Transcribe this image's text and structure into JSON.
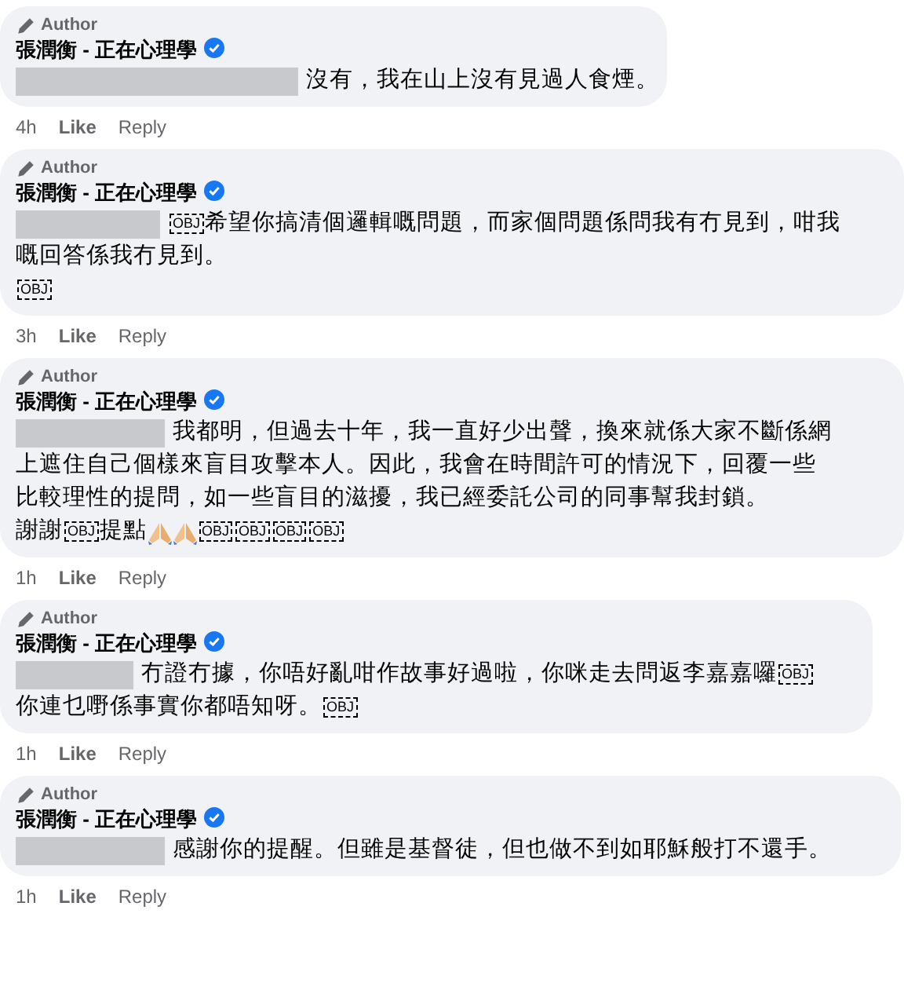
{
  "comments": [
    {
      "badge": "Author",
      "name": "張潤衡 - 正在心理學",
      "lines": [
        [
          {
            "kind": "redacted"
          },
          {
            "kind": "text",
            "text": "沒有，我在山上沒有見過人食煙。"
          }
        ]
      ],
      "time": "4h",
      "like": "Like",
      "reply": "Reply"
    },
    {
      "badge": "Author",
      "name": "張潤衡 - 正在心理學",
      "lines": [
        [
          {
            "kind": "redacted"
          },
          {
            "kind": "obj",
            "text": "OBJ"
          },
          {
            "kind": "text",
            "text": "希望你搞清個邏輯嘅問題，而家個問題係問我有冇見到，咁我"
          }
        ],
        [
          {
            "kind": "text",
            "text": "嘅回答係我冇見到。"
          }
        ],
        [
          {
            "kind": "obj",
            "text": "OBJ"
          }
        ]
      ],
      "time": "3h",
      "like": "Like",
      "reply": "Reply"
    },
    {
      "badge": "Author",
      "name": "張潤衡 - 正在心理學",
      "lines": [
        [
          {
            "kind": "redacted"
          },
          {
            "kind": "text",
            "text": "我都明，但過去十年，我一直好少出聲，換來就係大家不斷係網"
          }
        ],
        [
          {
            "kind": "text",
            "text": "上遮住自己個樣來盲目攻擊本人。因此，我會在時間許可的情況下，回覆一些"
          }
        ],
        [
          {
            "kind": "text",
            "text": "比較理性的提問，如一些盲目的滋擾，我已經委託公司的同事幫我封鎖。"
          }
        ],
        [
          {
            "kind": "text",
            "text": "謝謝"
          },
          {
            "kind": "obj",
            "text": "OBJ"
          },
          {
            "kind": "text",
            "text": "提點"
          },
          {
            "kind": "hands"
          },
          {
            "kind": "hands"
          },
          {
            "kind": "obj",
            "text": "OBJ"
          },
          {
            "kind": "obj",
            "text": "OBJ"
          },
          {
            "kind": "obj",
            "text": "OBJ"
          },
          {
            "kind": "obj",
            "text": "OBJ"
          }
        ]
      ],
      "time": "1h",
      "like": "Like",
      "reply": "Reply"
    },
    {
      "badge": "Author",
      "name": "張潤衡 - 正在心理學",
      "lines": [
        [
          {
            "kind": "redacted"
          },
          {
            "kind": "text",
            "text": "冇證冇據，你唔好亂咁作故事好過啦，你咪走去問返李嘉嘉囉"
          },
          {
            "kind": "obj",
            "text": "OBJ"
          }
        ],
        [
          {
            "kind": "text",
            "text": "你連乜嘢係事實你都唔知呀。"
          },
          {
            "kind": "obj",
            "text": "OBJ"
          }
        ]
      ],
      "time": "1h",
      "like": "Like",
      "reply": "Reply"
    },
    {
      "badge": "Author",
      "name": "張潤衡 - 正在心理學",
      "lines": [
        [
          {
            "kind": "redacted"
          },
          {
            "kind": "text",
            "text": "感謝你的提醒。但雖是基督徒，但也做不到如耶穌般打不還手。"
          }
        ]
      ],
      "time": "1h",
      "like": "Like",
      "reply": "Reply"
    }
  ]
}
